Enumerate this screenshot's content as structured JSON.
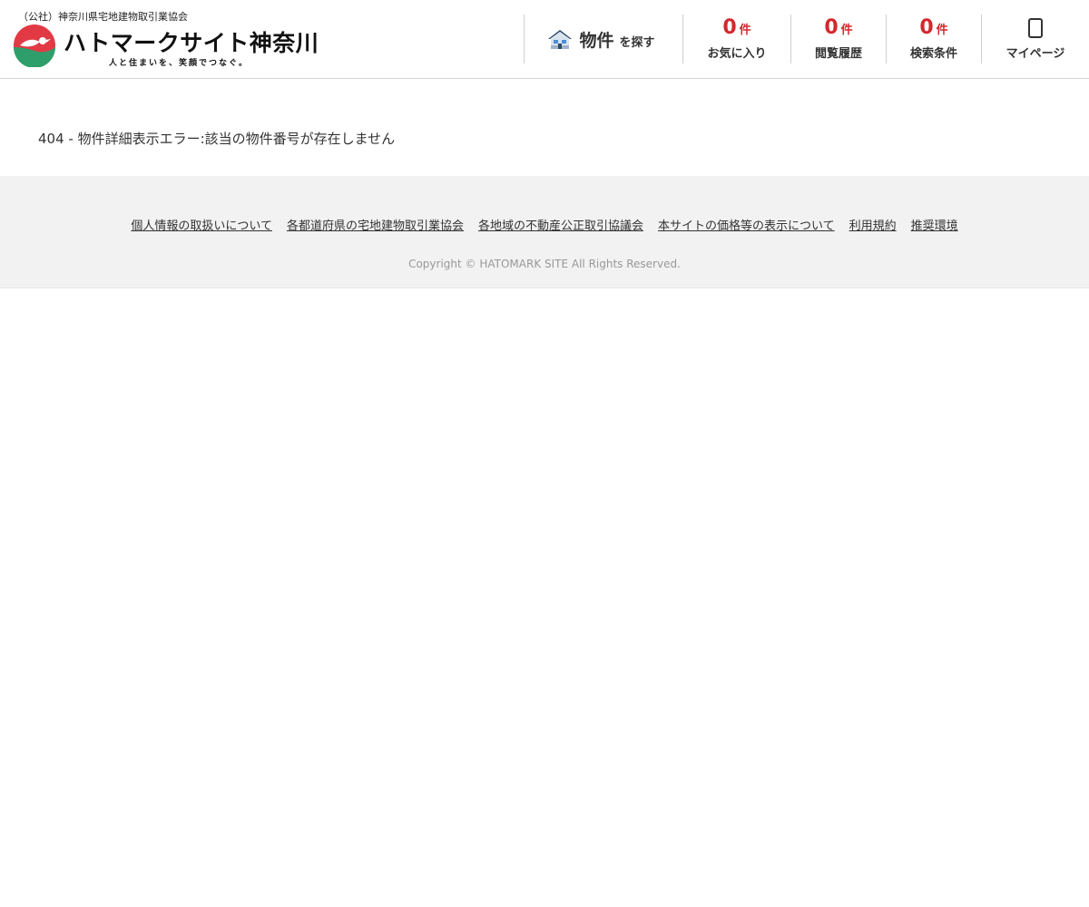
{
  "header": {
    "association": "（公社）神奈川県宅地建物取引業協会",
    "site_title": "ハトマークサイト神奈川",
    "tagline": "人と住まいを、笑顔でつなぐ。",
    "search": {
      "main": "物件",
      "sub": "を探す",
      "icon": "house-icon",
      "chevron_icon": "chevron-down-icon",
      "chevron_glyph": "",
      "chevron_color": "#4a8fd8"
    },
    "counters": [
      {
        "count": "0",
        "unit": "件",
        "label": "お気に入り"
      },
      {
        "count": "0",
        "unit": "件",
        "label": "閲覧履歴"
      },
      {
        "count": "0",
        "unit": "件",
        "label": "検索条件"
      }
    ],
    "mypage": {
      "label": "マイページ",
      "icon": "user-icon"
    }
  },
  "main": {
    "error_message": "404 - 物件詳細表示エラー:該当の物件番号が存在しません"
  },
  "footer": {
    "links": [
      "個人情報の取扱いについて",
      "各都道府県の宅地建物取引業協会",
      "各地域の不動産公正取引協議会",
      "本サイトの価格等の表示について",
      "利用規約",
      "推奨環境"
    ],
    "copyright": "Copyright © HATOMARK SITE All Rights Reserved."
  },
  "colors": {
    "accent_red": "#d3282d",
    "accent_green": "#2e9e6b",
    "footer_bg": "#f2f2f2",
    "link_blue": "#4a8fd8"
  }
}
